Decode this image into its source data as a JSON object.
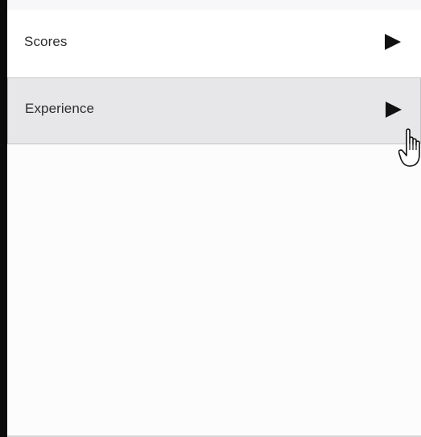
{
  "menu": {
    "items": [
      {
        "label": "Scores",
        "icon": "chevron-right-icon",
        "state": "normal"
      },
      {
        "label": "Experience",
        "icon": "chevron-right-icon",
        "state": "hovered"
      }
    ]
  },
  "cursor": {
    "icon": "hand-pointer-icon"
  },
  "colors": {
    "border_dark": "#0b0b0b",
    "item_hover_bg": "#e7e7e9",
    "item_bg": "#ffffff",
    "text": "#2d2d2d",
    "arrow": "#111111"
  }
}
